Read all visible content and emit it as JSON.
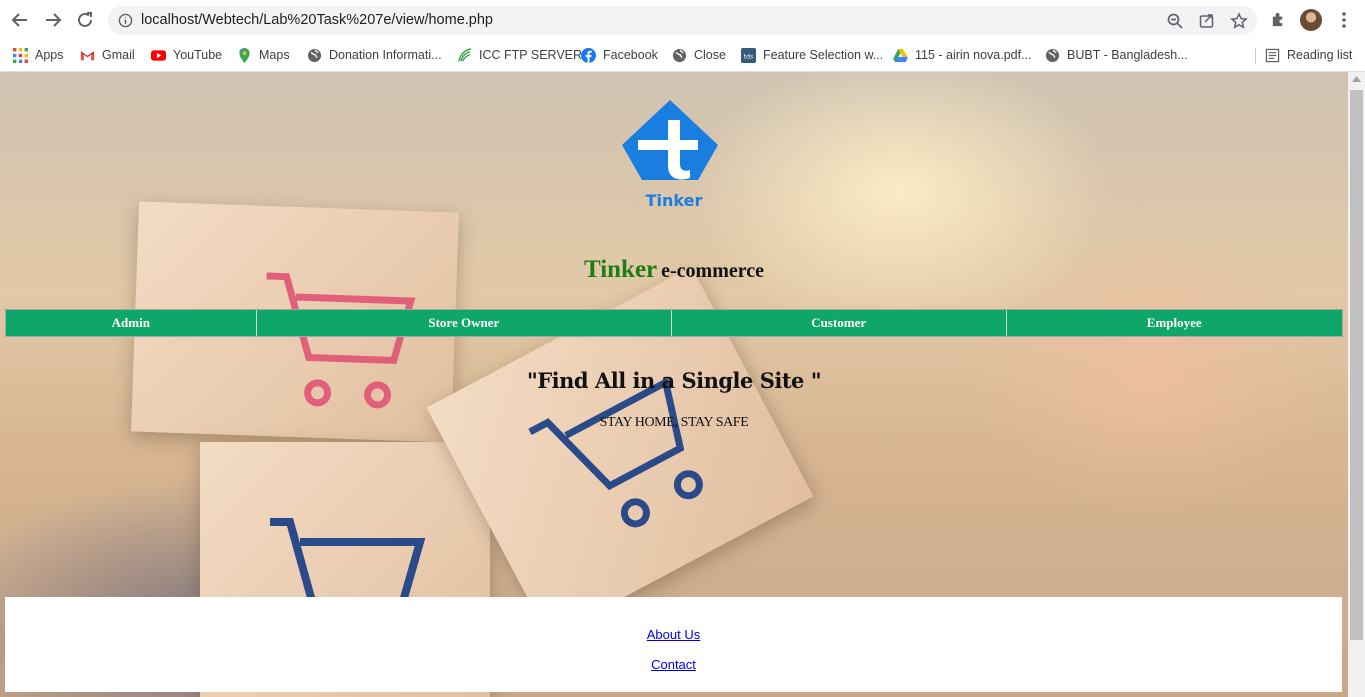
{
  "browser": {
    "url": "localhost/Webtech/Lab%20Task%207e/view/home.php",
    "bookmarks": [
      {
        "label": "Apps",
        "icon": "apps-grid-icon"
      },
      {
        "label": "Gmail",
        "icon": "gmail-icon"
      },
      {
        "label": "YouTube",
        "icon": "youtube-icon"
      },
      {
        "label": "Maps",
        "icon": "maps-pin-icon"
      },
      {
        "label": "Donation Informati...",
        "icon": "globe-icon"
      },
      {
        "label": "ICC FTP SERVER",
        "icon": "icc-leaf-icon"
      },
      {
        "label": "Facebook",
        "icon": "facebook-icon"
      },
      {
        "label": "Close",
        "icon": "globe-icon"
      },
      {
        "label": "Feature Selection w...",
        "icon": "tds-icon"
      },
      {
        "label": "115 - airin nova.pdf...",
        "icon": "google-drive-icon"
      },
      {
        "label": "BUBT - Bangladesh...",
        "icon": "globe-icon"
      }
    ],
    "reading_list": "Reading list"
  },
  "page": {
    "logo_text": "Tinker",
    "brand": "Tinker",
    "brand_suffix": "e-commerce",
    "nav": [
      "Admin",
      "Store Owner",
      "Customer",
      "Employee"
    ],
    "tagline": "\"Find All in a Single Site \"",
    "subtag": "STAY HOME, STAY SAFE",
    "footer_links": [
      "About Us",
      "Contact"
    ]
  },
  "colors": {
    "nav_bg": "#0fa769",
    "brand_green": "#1e7e15",
    "logo_blue": "#1a7de0",
    "link": "#0000ee"
  }
}
